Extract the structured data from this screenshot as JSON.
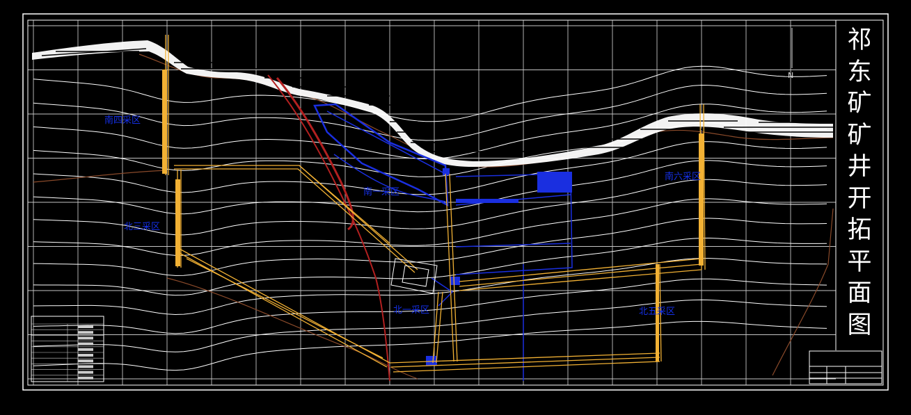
{
  "title": "祁东矿矿井开拓平面图",
  "zones": {
    "nanshi": "南四采区",
    "nanyi": "南一采区",
    "beisan": "北三采区",
    "beiyi": "北一采区",
    "beiwu": "北五采区",
    "nanliu": "南六采区"
  },
  "north_label": "N",
  "colors": {
    "background": "#000000",
    "contour": "#ffffff",
    "roadway": "#f2b134",
    "fault": "#b32020",
    "mined_area": "#1a2fe0",
    "grid": "#e8e8e8"
  }
}
